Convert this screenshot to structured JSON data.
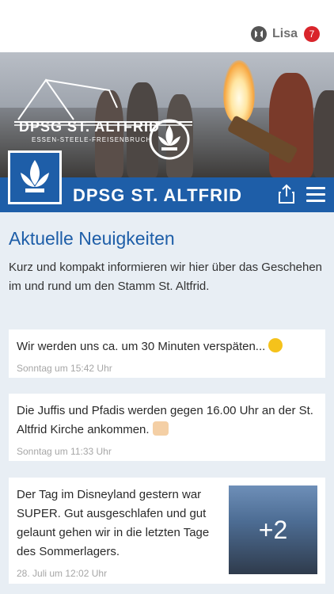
{
  "user": {
    "name": "Lisa",
    "badge": "7"
  },
  "hero": {
    "title": "DPSG ST. ALTFRID",
    "subtitle": "ESSEN-STEELE-FREISENBRUCH"
  },
  "banner": {
    "title": "DPSG ST. ALTFRID"
  },
  "main": {
    "title": "Aktuelle Neuigkeiten",
    "intro": "Kurz und kompakt informieren wir hier über das Geschehen im und rund um den Stamm St. Altfrid."
  },
  "posts": [
    {
      "text": "Wir werden uns ca. um 30 Minuten verspäten... ",
      "emoji": "smiley",
      "time": "Sonntag um 15:42 Uhr"
    },
    {
      "text": "Die Juffis und Pfadis werden gegen 16.00 Uhr an der St. Altfrid Kirche ankommen. ",
      "emoji": "thumbs-up",
      "time": "Sonntag um 11:33 Uhr"
    },
    {
      "text": "Der Tag im Disneyland gestern war SUPER. Gut ausgeschlafen und gut gelaunt gehen wir in die letzten Tage des Sommerlagers.",
      "time": "28. Juli um 12:02 Uhr",
      "photo_more": "+2"
    }
  ],
  "colors": {
    "brand": "#1e5ea8",
    "badge": "#d9252b",
    "background": "#e8eef4"
  },
  "icons": [
    "user-logo-icon",
    "share-icon",
    "menu-icon",
    "lily-logo-icon",
    "smiley-emoji-icon",
    "thumbs-up-emoji-icon"
  ]
}
